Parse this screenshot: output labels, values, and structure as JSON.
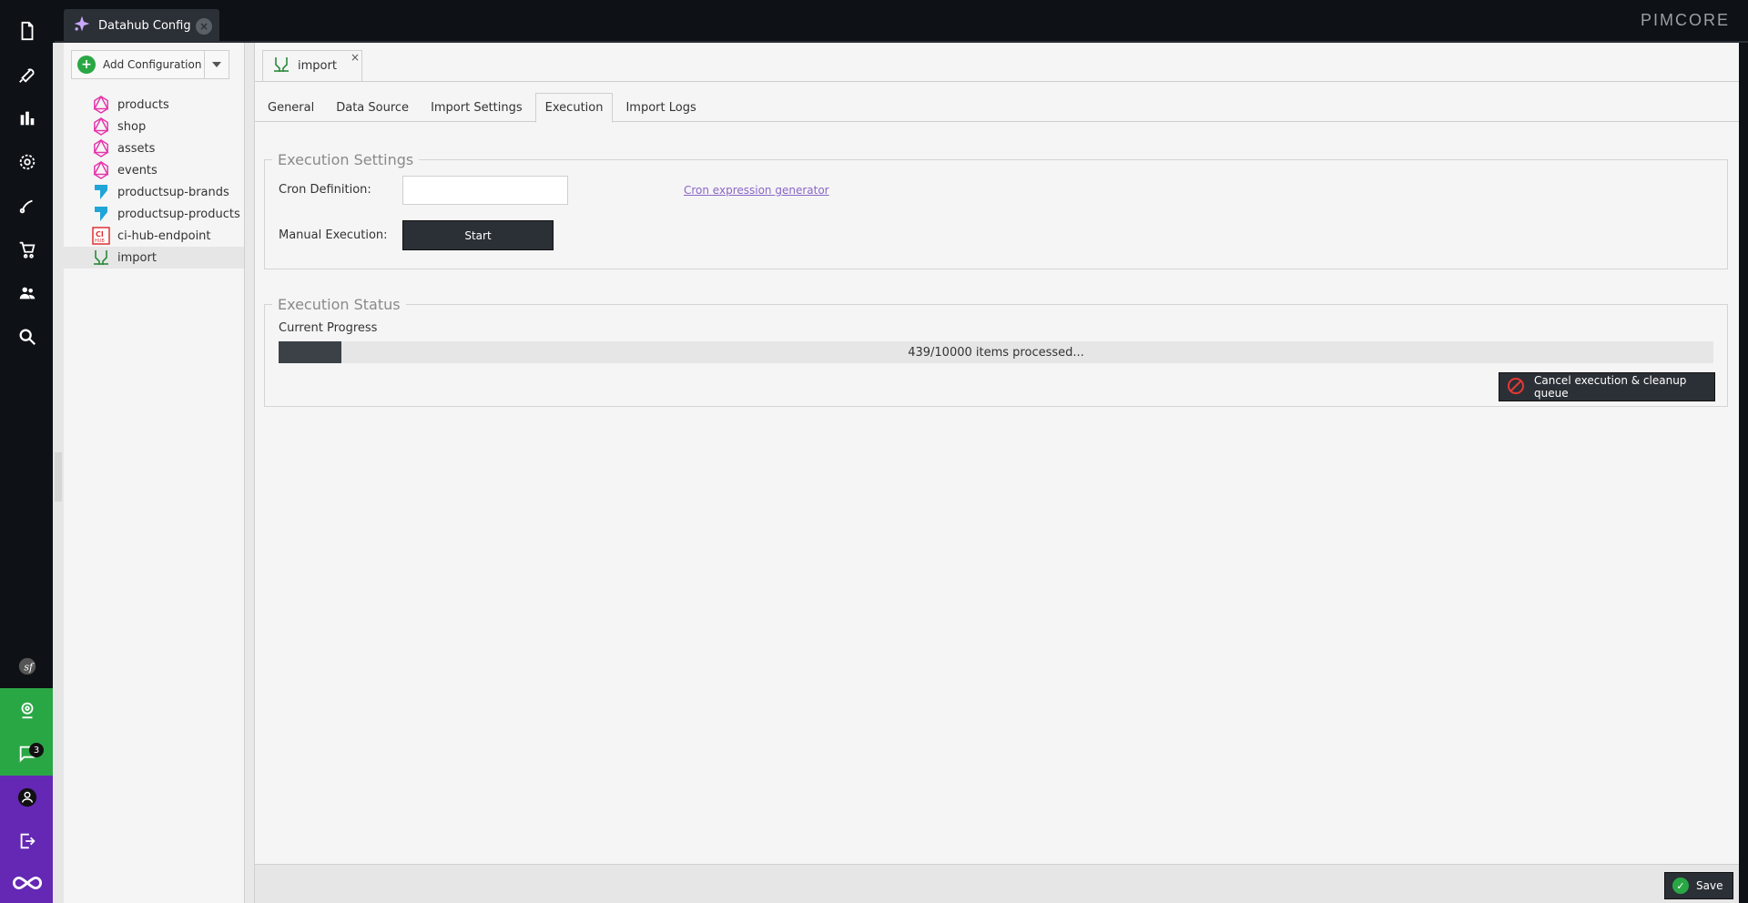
{
  "topbar": {
    "main_tab": "Datahub Config",
    "logo": "PIMCORE"
  },
  "rail": {
    "icons": [
      "document-icon",
      "wrench-icon",
      "chart-icon",
      "gear-icon",
      "paint-icon",
      "cart-icon",
      "users-icon",
      "search-icon",
      "symfony-icon",
      "support-icon",
      "chat-icon",
      "user-icon",
      "logout-icon",
      "infinity-icon"
    ],
    "chat_badge": "3"
  },
  "tree": {
    "add_label": "Add Configuration",
    "items": [
      {
        "label": "products",
        "icon": "graphql-icon"
      },
      {
        "label": "shop",
        "icon": "graphql-icon"
      },
      {
        "label": "assets",
        "icon": "graphql-icon"
      },
      {
        "label": "events",
        "icon": "graphql-icon"
      },
      {
        "label": "productsup-brands",
        "icon": "productsup-icon"
      },
      {
        "label": "productsup-products",
        "icon": "productsup-icon"
      },
      {
        "label": "ci-hub-endpoint",
        "icon": "cihub-icon"
      },
      {
        "label": "import",
        "icon": "import-icon"
      }
    ]
  },
  "doc_tab": {
    "label": "import"
  },
  "subtabs": [
    "General",
    "Data Source",
    "Import Settings",
    "Execution",
    "Import Logs"
  ],
  "execution_settings": {
    "legend": "Execution Settings",
    "cron_label": "Cron Definition:",
    "cron_value": "",
    "cron_link": "Cron expression generator",
    "manual_label": "Manual Execution:",
    "start_label": "Start"
  },
  "execution_status": {
    "legend": "Execution Status",
    "progress_label": "Current Progress",
    "progress_text": "439/10000 items processed...",
    "progress_fraction": 0.0439,
    "cancel_label": "Cancel execution & cleanup queue"
  },
  "footer": {
    "save_label": "Save"
  },
  "colors": {
    "accent_green": "#2aa745",
    "accent_purple": "#6428b4",
    "dark": "#2b2f36",
    "link": "#8a66c8"
  }
}
